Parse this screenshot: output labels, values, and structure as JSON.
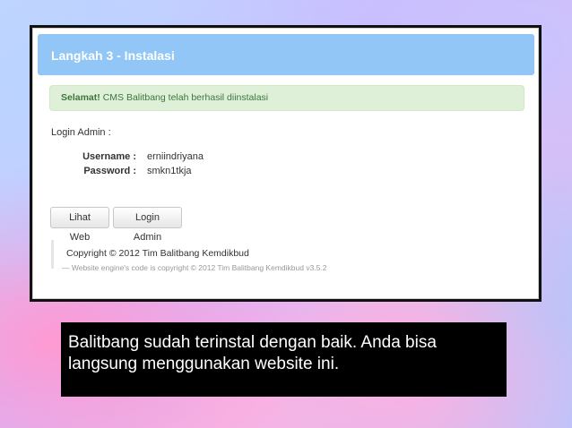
{
  "header": {
    "title": "Langkah 3 - Instalasi"
  },
  "alert": {
    "strong": "Selamat!",
    "message": "CMS Balitbang telah berhasil diinstalasi"
  },
  "login": {
    "heading": "Login Admin :",
    "username_label": "Username :",
    "username_value": "erniindriyana",
    "password_label": "Password :",
    "password_value": "smkn1tkja"
  },
  "buttons": {
    "view_web": "Lihat Web",
    "login_admin": "Login Admin"
  },
  "footer": {
    "copyright": "Copyright © 2012 Tim Balitbang Kemdikbud",
    "engine": "— Website engine's code is copyright © 2012 Tim Balitbang Kemdikbud v3.5.2"
  },
  "caption": {
    "text": "Balitbang sudah terinstal dengan baik. Anda bisa langsung menggunakan website ini."
  }
}
